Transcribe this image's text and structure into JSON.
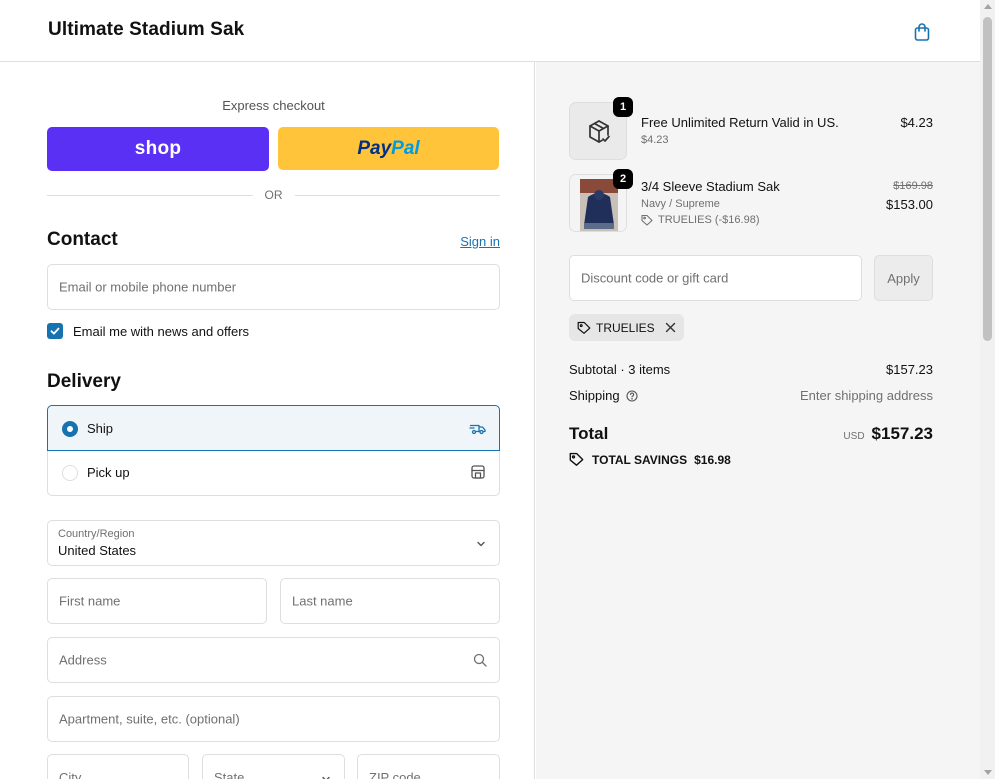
{
  "header": {
    "brand": "Ultimate Stadium Sak",
    "cart_icon": "shopping-bag-icon"
  },
  "express": {
    "label": "Express checkout",
    "shop_label": "shop",
    "paypal_a": "Pay",
    "paypal_b": "Pal",
    "or": "OR"
  },
  "contact": {
    "title": "Contact",
    "signin": "Sign in",
    "email_placeholder": "Email or mobile phone number",
    "newsletter_label": "Email me with news and offers",
    "newsletter_checked": true
  },
  "delivery": {
    "title": "Delivery",
    "options": [
      {
        "label": "Ship",
        "selected": true,
        "icon": "truck-icon"
      },
      {
        "label": "Pick up",
        "selected": false,
        "icon": "store-icon"
      }
    ],
    "country_label": "Country/Region",
    "country_value": "United States",
    "first_name": "First name",
    "last_name": "Last name",
    "address": "Address",
    "apartment": "Apartment, suite, etc. (optional)",
    "city": "City",
    "state": "State",
    "zip": "ZIP code"
  },
  "summary": {
    "items": [
      {
        "qty": "1",
        "name": "Free Unlimited Return Valid in US.",
        "sub": "$4.23",
        "price": "$4.23"
      },
      {
        "qty": "2",
        "name": "3/4 Sleeve Stadium Sak",
        "variant": "Navy / Supreme",
        "discount": "TRUELIES (-$16.98)",
        "original_price": "$169.98",
        "price": "$153.00"
      }
    ],
    "discount_placeholder": "Discount code or gift card",
    "apply_label": "Apply",
    "applied_code": "TRUELIES",
    "subtotal_label": "Subtotal · 3 items",
    "subtotal_value": "$157.23",
    "shipping_label": "Shipping",
    "shipping_value": "Enter shipping address",
    "total_label": "Total",
    "currency": "USD",
    "total_value": "$157.23",
    "savings_label": "TOTAL SAVINGS",
    "savings_value": "$16.98"
  },
  "colors": {
    "accent": "#1773b0",
    "shop": "#5a31f4",
    "paypal": "#ffc439"
  }
}
